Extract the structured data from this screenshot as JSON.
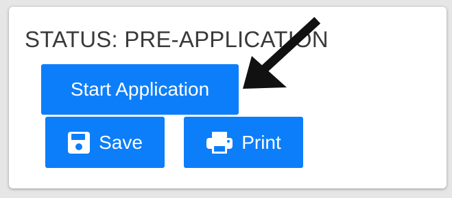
{
  "status": {
    "title": "STATUS: PRE-APPLICATION"
  },
  "buttons": {
    "start_label": "Start Application",
    "save_label": "Save",
    "print_label": "Print"
  },
  "icons": {
    "save": "floppy-disk-icon",
    "print": "printer-icon",
    "pointer": "arrow-icon"
  },
  "colors": {
    "button": "#0d7ef9",
    "text": "#3a3a3a",
    "background": "#e6e6e6",
    "card": "#ffffff",
    "arrow": "#111111"
  }
}
